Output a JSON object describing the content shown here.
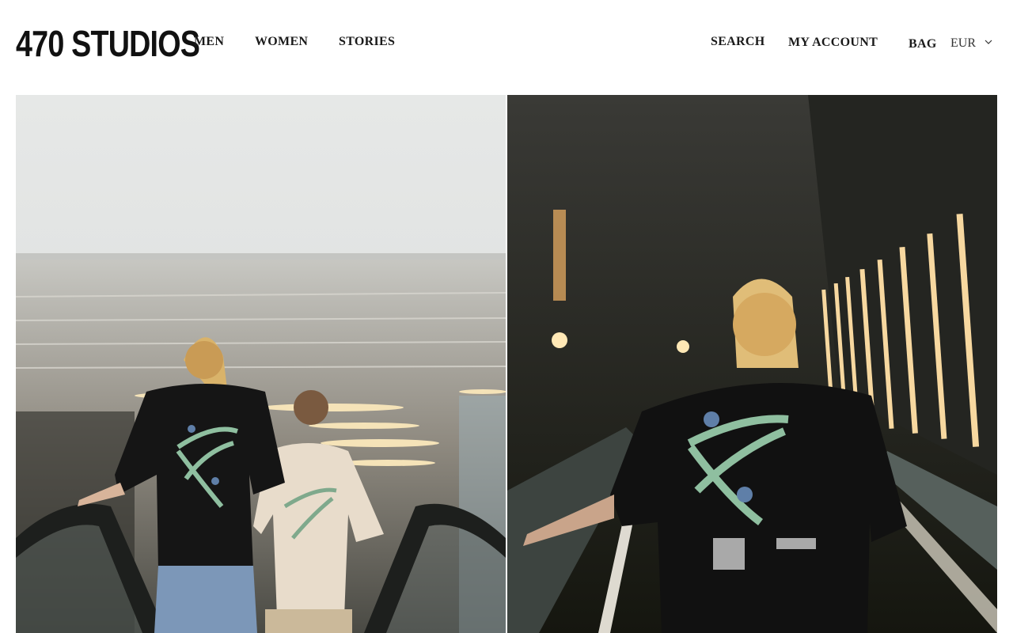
{
  "header": {
    "logo": "470 STUDIOS",
    "nav": {
      "men": "MEN",
      "women": "WOMEN",
      "stories": "STORIES"
    },
    "utility": {
      "search": "SEARCH",
      "account": "MY ACCOUNT",
      "bag": "BAG",
      "currency": "EUR"
    }
  },
  "hero": {
    "left_image": "photo of two people wearing 470 Studios t-shirts riding an escalator in a bright atrium",
    "right_image": "photo of a woman in a black 470 Studios t-shirt riding an escalator under dark ceiling with light strips"
  },
  "colors": {
    "text": "#1a1a1a",
    "background": "#ffffff",
    "print_green": "#8fbfa0"
  }
}
